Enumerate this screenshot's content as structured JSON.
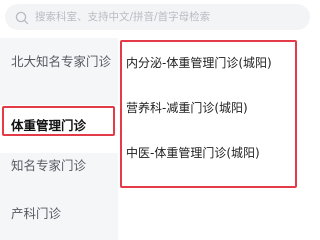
{
  "search": {
    "placeholder": "搜索科室、支持中文/拼音/首字母检索"
  },
  "sidebar": {
    "items": [
      {
        "label": "北大知名专家门诊"
      },
      {
        "label": "体重管理门诊"
      },
      {
        "label": "知名专家门诊"
      },
      {
        "label": "产科门诊"
      }
    ],
    "active_index": 1
  },
  "content": {
    "items": [
      {
        "label": "内分泌-体重管理门诊(城阳)"
      },
      {
        "label": "营养科-减重门诊(城阳)"
      },
      {
        "label": "中医-体重管理门诊(城阳)"
      }
    ]
  },
  "colors": {
    "highlight_border": "#e33b48",
    "sidebar_bg": "#f5f6f8",
    "search_bg": "#f3f4f6"
  },
  "icons": {
    "search": "search-icon"
  }
}
